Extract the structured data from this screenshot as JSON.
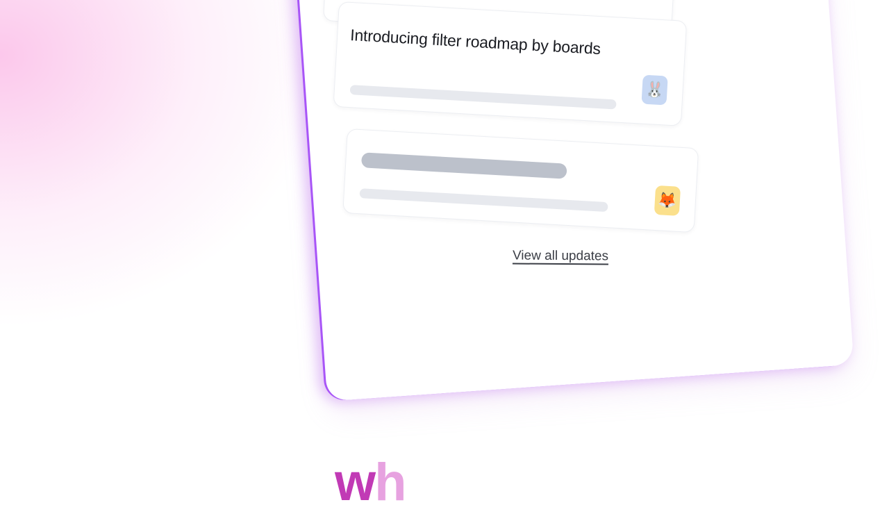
{
  "updates": {
    "card1": {
      "title": "Introducing filter roadmap by boards",
      "avatar_icon": "rabbit-icon"
    },
    "card2": {
      "avatar_icon": "fox-icon"
    },
    "view_all_label": "View all updates"
  },
  "headline_fragment": {
    "part1": "w",
    "part2": "h"
  },
  "colors": {
    "panel_edge": "#a855f7",
    "headline_dark": "#c13ab5",
    "headline_light": "#e7a2e0",
    "rabbit_badge": "#c7d8f4",
    "fox_badge": "#fbe08c"
  }
}
